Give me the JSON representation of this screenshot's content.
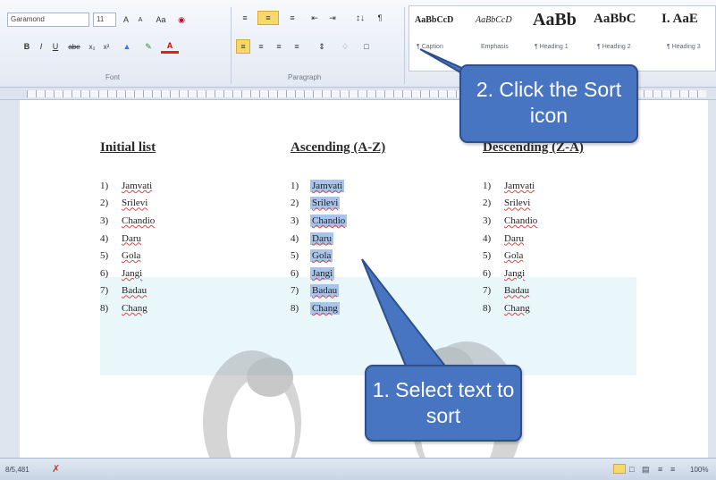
{
  "ribbon": {
    "font_name": "Garamond",
    "font_size": "11",
    "groups": {
      "font": "Font",
      "paragraph": "Paragraph"
    },
    "tools": [
      "A",
      "A",
      "Aa",
      "B",
      "I",
      "U",
      "abe",
      "x₂",
      "x²",
      "A",
      "¶"
    ],
    "styles": [
      {
        "preview": "AaBbCcD",
        "name": "¶ Caption"
      },
      {
        "preview": "AaBbCcD",
        "name": "Emphasis"
      },
      {
        "preview": "AaBb",
        "name": "¶ Heading 1"
      },
      {
        "preview": "AaBbC",
        "name": "¶ Heading 2"
      },
      {
        "preview": "I. AaE",
        "name": "¶ Heading 3"
      }
    ]
  },
  "document": {
    "columns": [
      {
        "heading": "Initial list",
        "highlighted": false,
        "items": [
          "Jamvati",
          "Srilevi",
          "Chandio",
          "Daru",
          "Gola",
          "Jangi",
          "Badau",
          "Chang"
        ]
      },
      {
        "heading": "Ascending (A-Z)",
        "highlighted": true,
        "items": [
          "Jamvati",
          "Srilevi",
          "Chandio",
          "Daru",
          "Gola",
          "Jangi",
          "Badau",
          "Chang"
        ]
      },
      {
        "heading": "Descending (Z-A)",
        "highlighted": false,
        "items": [
          "Jamvati",
          "Srilevi",
          "Chandio",
          "Daru",
          "Gola",
          "Jangi",
          "Badau",
          "Chang"
        ]
      }
    ],
    "numbers": [
      "1)",
      "2)",
      "3)",
      "4)",
      "5)",
      "6)",
      "7)",
      "8)"
    ]
  },
  "callouts": {
    "sort_icon": "2. Click the Sort icon",
    "select_text": "1. Select text to sort"
  },
  "status": {
    "words": "8/5,481",
    "zoom": "100%"
  },
  "colors": {
    "callout": "#4775c2",
    "highlight": "#a9c4eb",
    "selected_tool": "#f6d86b"
  }
}
